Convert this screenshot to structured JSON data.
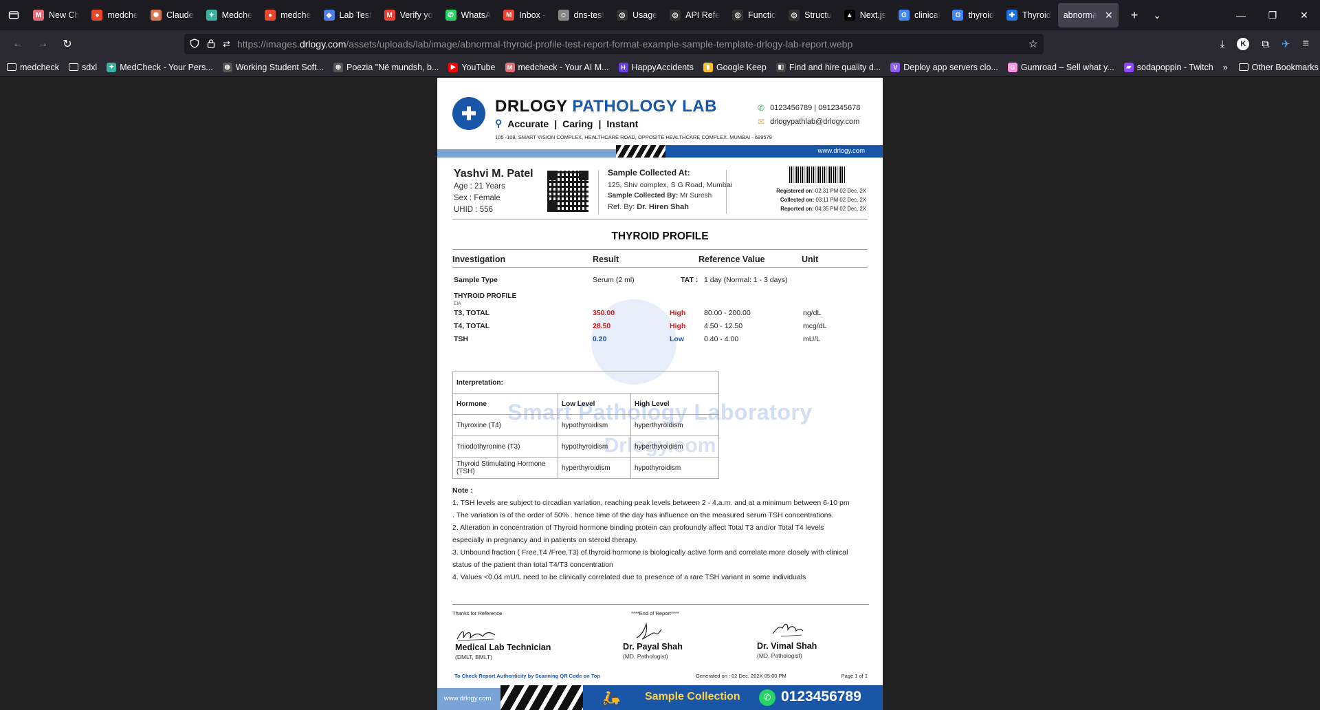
{
  "browser": {
    "tabs": [
      {
        "label": "New Ch",
        "fav": "M",
        "color": "#e06c75",
        "active": false
      },
      {
        "label": "medche",
        "fav": "●",
        "color": "#e8482c",
        "active": false
      },
      {
        "label": "Claude",
        "fav": "✺",
        "color": "#d97757",
        "active": false
      },
      {
        "label": "Medche",
        "fav": "✦",
        "color": "#3bb0a0",
        "active": false
      },
      {
        "label": "medche",
        "fav": "●",
        "color": "#e8482c",
        "active": false
      },
      {
        "label": "Lab Test",
        "fav": "◆",
        "color": "#4a7de8",
        "active": false
      },
      {
        "label": "Verify yo",
        "fav": "M",
        "color": "#ea4335",
        "active": false
      },
      {
        "label": "WhatsA",
        "fav": "✆",
        "color": "#25d366",
        "active": false
      },
      {
        "label": "Inbox -",
        "fav": "M",
        "color": "#ea4335",
        "active": false
      },
      {
        "label": "dns-test",
        "fav": "☺",
        "color": "#888888",
        "active": false
      },
      {
        "label": "Usage",
        "fav": "◎",
        "color": "#333333",
        "active": false
      },
      {
        "label": "API Refe",
        "fav": "◎",
        "color": "#333333",
        "active": false
      },
      {
        "label": "Functio",
        "fav": "◎",
        "color": "#333333",
        "active": false
      },
      {
        "label": "Structu",
        "fav": "◎",
        "color": "#333333",
        "active": false
      },
      {
        "label": "Next.js",
        "fav": "▲",
        "color": "#000000",
        "active": false
      },
      {
        "label": "clinical",
        "fav": "G",
        "color": "#4285f4",
        "active": false
      },
      {
        "label": "thyroid",
        "fav": "G",
        "color": "#4285f4",
        "active": false
      },
      {
        "label": "Thyroid",
        "fav": "✚",
        "color": "#1a73e8",
        "active": false
      },
      {
        "label": "abnorma",
        "fav": "",
        "color": "",
        "active": true
      }
    ],
    "url_host_prefix": "https://images.",
    "url_host": "drlogy.com",
    "url_path": "/assets/uploads/lab/image/abnormal-thyroid-profile-test-report-format-example-sample-template-drlogy-lab-report.webp",
    "account_letter": "K",
    "bookmarks": [
      {
        "label": "medcheck",
        "icon": "folder"
      },
      {
        "label": "sdxl",
        "icon": "folder"
      },
      {
        "label": "MedCheck - Your Pers...",
        "icon": "fav",
        "fav": "✦",
        "color": "#3bb0a0"
      },
      {
        "label": "Working Student Soft...",
        "icon": "fav",
        "fav": "◍",
        "color": "#555555"
      },
      {
        "label": "Poezia \"Në mundsh, b...",
        "icon": "fav",
        "fav": "◍",
        "color": "#555555"
      },
      {
        "label": "YouTube",
        "icon": "fav",
        "fav": "▶",
        "color": "#ff0000"
      },
      {
        "label": "medcheck - Your AI M...",
        "icon": "fav",
        "fav": "M",
        "color": "#e06c75"
      },
      {
        "label": "HappyAccidents",
        "icon": "fav",
        "fav": "H",
        "color": "#6a3de8"
      },
      {
        "label": "Google Keep",
        "icon": "fav",
        "fav": "▮",
        "color": "#f6bf26"
      },
      {
        "label": "Find and hire quality d...",
        "icon": "fav",
        "fav": "◧",
        "color": "#444444"
      },
      {
        "label": "Deploy app servers clo...",
        "icon": "fav",
        "fav": "V",
        "color": "#8e5cf7"
      },
      {
        "label": "Gumroad – Sell what y...",
        "icon": "fav",
        "fav": "G",
        "color": "#ff90e8"
      },
      {
        "label": "sodapoppin - Twitch",
        "icon": "fav",
        "fav": "▰",
        "color": "#9146ff"
      }
    ],
    "other_bookmarks": "Other Bookmarks"
  },
  "report": {
    "lab_name_1": "DRLOGY ",
    "lab_name_2": "PATHOLOGY LAB",
    "tagline": [
      "Accurate",
      "|",
      "Caring",
      "|",
      "Instant"
    ],
    "address": "105 -108, SMART VISION COMPLEX, HEALTHCARE ROAD, OPPOSITE HEALTHCARE COMPLEX. MUMBAI - 689578",
    "phone": "0123456789  | 0912345678",
    "email": "drlogypathlab@drlogy.com",
    "website": "www.drlogy.com",
    "patient": {
      "name": "Yashvi M. Patel",
      "age": "Age : 21 Years",
      "sex": "Sex : Female",
      "uhid": "UHID : 556"
    },
    "collection": {
      "title": "Sample Collected At:",
      "address": "125, Shiv complex, S G Road, Mumbai",
      "by_label": "Sample Collected By:",
      "by_value": " Mr Suresh",
      "ref_label": "Ref. By: ",
      "ref_value": "Dr. Hiren Shah"
    },
    "dates": {
      "registered_label": "Registered on:",
      "registered": " 02:31 PM 02 Dec, 2X",
      "collected_label": "Collected on:",
      "collected": " 03:11 PM 02 Dec, 2X",
      "reported_label": "Reported on:",
      "reported": " 04:35 PM 02 Dec, 2X"
    },
    "title": "THYROID PROFILE",
    "headers": {
      "investigation": "Investigation",
      "result": "Result",
      "reference": "Reference Value",
      "unit": "Unit"
    },
    "sample_type_label": "Sample Type",
    "sample_type_value": "Serum (2 ml)",
    "tat_label": "TAT :",
    "tat_value": "1 day  (Normal: 1 - 3 days)",
    "section": "THYROID PROFILE",
    "section_method": "EIA",
    "rows": [
      {
        "name": "T3, TOTAL",
        "result": "350.00",
        "flag": "High",
        "ref": "80.00 - 200.00",
        "unit": "ng/dL"
      },
      {
        "name": "T4, TOTAL",
        "result": "28.50",
        "flag": "High",
        "ref": "4.50 - 12.50",
        "unit": "mcg/dL"
      },
      {
        "name": "TSH",
        "result": "0.20",
        "flag": "Low",
        "ref": "0.40 - 4.00",
        "unit": "mU/L"
      }
    ],
    "watermark_1": "Smart Pathology Laboratory",
    "watermark_2": "Drlogy.com",
    "interpretation": {
      "title": "Interpretation:",
      "headers": [
        "Hormone",
        "Low Level",
        "High Level"
      ],
      "rows": [
        [
          "Thyroxine (T4)",
          "hypothyroidism",
          "hyperthyroidism"
        ],
        [
          "Triiodothyronine (T3)",
          "hypothyroidism",
          "hyperthyroidism"
        ],
        [
          "Thyroid Stimulating Hormone (TSH)",
          "hyperthyroidism",
          "hypothyroidism"
        ]
      ]
    },
    "notes_title": "Note :",
    "notes": [
      "1. TSH levels are subject to circadian variation, reaching peak levels between 2 - 4.a.m. and at a minimum between 6-10 pm . The variation is of the order of 50% . hence time of the day has influence on the measured serum TSH concentrations.",
      "2. Alteration in concentration of Thyroid hormone binding protein can profoundly affect Total T3 and/or Total T4 levels especially in pregnancy and in patients on steroid therapy.",
      "3. Unbound fraction ( Free,T4 /Free,T3) of thyroid hormone is biologically active form and correlate more closely with clinical status of the patient than total T4/T3 concentration",
      "4. Values <0.04 mU/L need to be clinically correlated due to presence of a rare TSH variant in some individuals"
    ],
    "thanks": "Thanks for Reference",
    "end_of_report": "****End of Report****",
    "signatories": [
      {
        "name": "Medical Lab Technician",
        "degree": "(DMLT, BMLT)"
      },
      {
        "name": "Dr. Payal Shah",
        "degree": "(MD, Pathologist)"
      },
      {
        "name": "Dr. Vimal Shah",
        "degree": "(MD, Pathologist)"
      }
    ],
    "check_text": "To Check Report Authenticity by Scanning QR Code on Top",
    "generated": "Generated on :  02 Dec, 202X 05:00 PM",
    "page": "Page 1 of 1",
    "bottom_url": "www.drlogy.com",
    "sample_collection": "Sample Collection",
    "bottom_phone": "0123456789"
  }
}
